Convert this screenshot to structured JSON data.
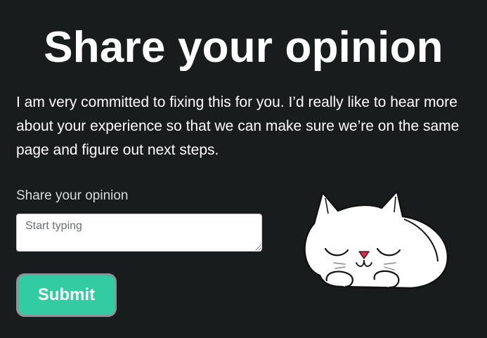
{
  "header": {
    "title": "Share your opinion"
  },
  "intro": {
    "text": "I am very committed to fixing this for you. I’d really like to hear more about your experience so that we can make sure we’re on the same page and figure out next steps."
  },
  "form": {
    "label": "Share your opinion",
    "placeholder": "Start typing",
    "value": "",
    "submit_label": "Submit"
  },
  "illustration": {
    "icon": "sleeping-cat-icon"
  },
  "colors": {
    "background": "#181c1d",
    "text": "#ffffff",
    "button": "#33cca0",
    "button_border": "#8d9296",
    "cat_nose": "#e8274b"
  }
}
